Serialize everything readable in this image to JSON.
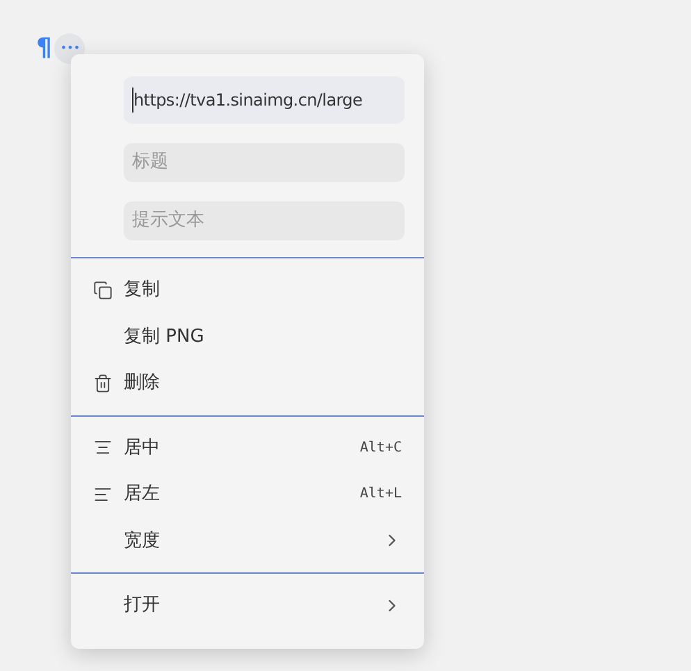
{
  "toolbar": {
    "paragraph_mark": "¶",
    "more": "•••"
  },
  "fields": [
    {
      "value": "https://tva1.sinaimg.cn/large"
    },
    {
      "placeholder": "标题"
    },
    {
      "placeholder": "提示文本"
    }
  ],
  "menu_sections": [
    [
      {
        "label": "复制"
      },
      {
        "label": "复制 PNG"
      },
      {
        "label": "删除"
      }
    ],
    [
      {
        "label": "居中",
        "shortcut": "Alt+C"
      },
      {
        "label": "居左",
        "shortcut": "Alt+L"
      },
      {
        "label": "宽度",
        "has_submenu": true
      }
    ],
    [
      {
        "label": "打开",
        "has_submenu": true
      }
    ]
  ]
}
